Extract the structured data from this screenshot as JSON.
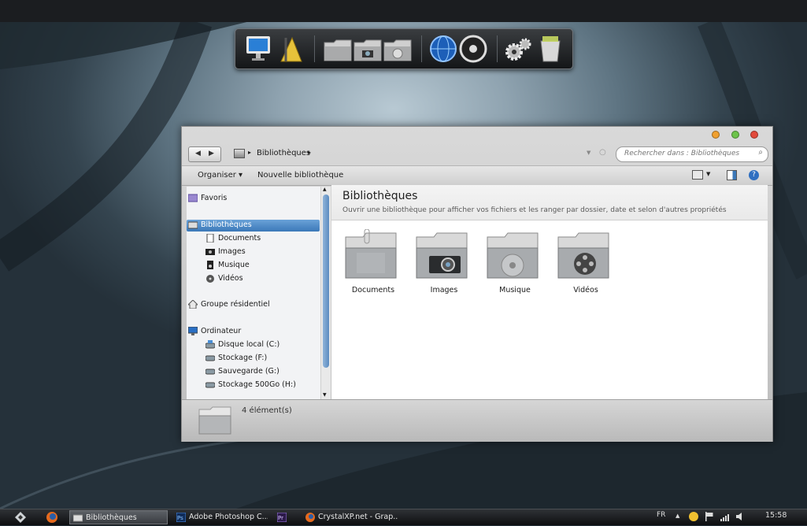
{
  "explorer": {
    "breadcrumb": [
      "Bibliothèques"
    ],
    "search_placeholder": "Rechercher dans : Bibliothèques",
    "toolbar": {
      "organize": "Organiser",
      "new_library": "Nouvelle bibliothèque"
    },
    "nav": {
      "favorites": "Favoris",
      "libraries": "Bibliothèques",
      "library_items": [
        "Documents",
        "Images",
        "Musique",
        "Vidéos"
      ],
      "homegroup": "Groupe résidentiel",
      "computer": "Ordinateur",
      "drives": [
        "Disque local (C:)",
        "Stockage (F:)",
        "Sauvegarde (G:)",
        "Stockage 500Go (H:)"
      ]
    },
    "content": {
      "title": "Bibliothèques",
      "subtitle": "Ouvrir une bibliothèque pour afficher vos fichiers et les ranger par dossier, date et selon d'autres propriétés",
      "tiles": [
        "Documents",
        "Images",
        "Musique",
        "Vidéos"
      ]
    },
    "status": "4 élément(s)"
  },
  "taskbar": {
    "tasks": [
      "Bibliothèques",
      "Adobe Photoshop C...",
      "CrystalXP.net - Grap..."
    ],
    "lang": "FR",
    "clock": "15:58"
  },
  "colors": {
    "accent": "#3b78b8",
    "desktop": "#5e7482"
  }
}
